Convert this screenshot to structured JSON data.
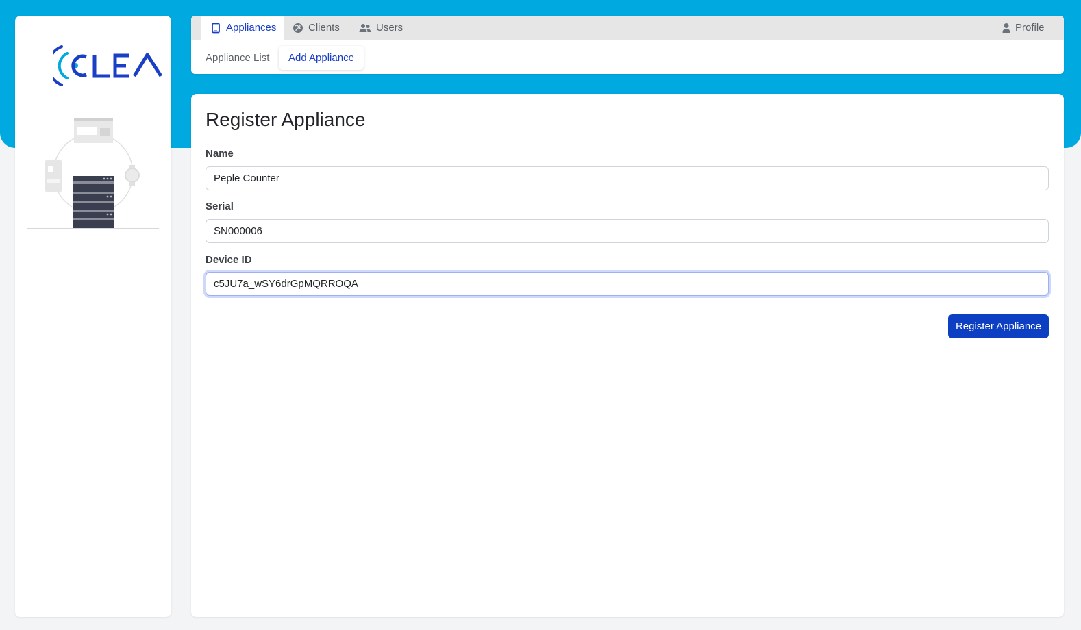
{
  "brand": {
    "logo_text": "CLEA",
    "accent_color": "#00a9e0",
    "primary_color": "#0d3fc2"
  },
  "top_tabs": [
    {
      "label": "Appliances",
      "icon": "tablet-icon",
      "active": true
    },
    {
      "label": "Clients",
      "icon": "globe-icon",
      "active": false
    },
    {
      "label": "Users",
      "icon": "users-icon",
      "active": false
    }
  ],
  "profile": {
    "label": "Profile",
    "icon": "user-icon"
  },
  "sub_nav": [
    {
      "label": "Appliance List",
      "active": false
    },
    {
      "label": "Add Appliance",
      "active": true
    }
  ],
  "form": {
    "title": "Register Appliance",
    "fields": {
      "name": {
        "label": "Name",
        "value": "Peple Counter"
      },
      "serial": {
        "label": "Serial",
        "value": "SN000006"
      },
      "device_id": {
        "label": "Device ID",
        "value": "c5JU7a_wSY6drGpMQRROQA"
      }
    },
    "submit_label": "Register Appliance"
  }
}
